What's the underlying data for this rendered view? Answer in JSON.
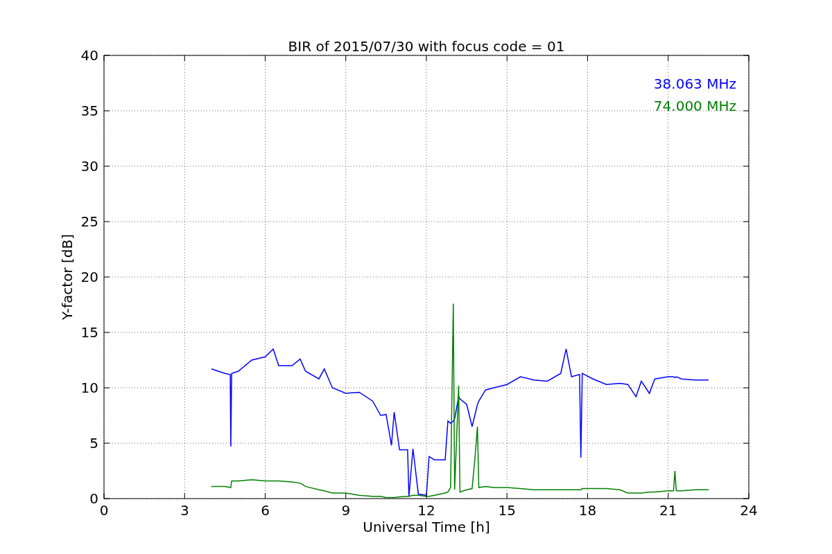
{
  "figure": {
    "chart_data": {
      "type": "line",
      "title": "BIR of 2015/07/30 with focus code = 01",
      "xlabel": "Universal Time [h]",
      "ylabel": "Y-factor [dB]",
      "grid": true,
      "xlim": [
        0,
        24
      ],
      "ylim": [
        0,
        40
      ],
      "xticks": [
        0,
        3,
        6,
        9,
        12,
        15,
        18,
        21,
        24
      ],
      "yticks": [
        0,
        5,
        10,
        15,
        20,
        25,
        30,
        35,
        40
      ],
      "x": [
        4,
        4.5,
        4.7,
        4.72,
        4.75,
        5,
        5.5,
        6,
        6.3,
        6.5,
        7,
        7.3,
        7.5,
        8,
        8.2,
        8.5,
        9,
        9.5,
        10,
        10.3,
        10.5,
        10.7,
        10.8,
        11,
        11.3,
        11.35,
        11.5,
        11.7,
        12,
        12.1,
        12.3,
        12.7,
        12.8,
        12.9,
        13,
        13.05,
        13.2,
        13.25,
        13.5,
        13.7,
        13.8,
        13.9,
        13.95,
        14.2,
        14.5,
        15,
        15.5,
        16,
        16.5,
        17,
        17.2,
        17.4,
        17.7,
        17.75,
        17.8,
        18.2,
        18.7,
        19.2,
        19.5,
        19.8,
        20,
        20.3,
        20.5,
        21,
        21.2,
        21.25,
        21.3,
        21.5,
        22,
        22.5
      ],
      "series": [
        {
          "name": "38.063 MHz",
          "color": "#0000ff",
          "values": [
            11.7,
            11.3,
            11.2,
            4.7,
            11.3,
            11.5,
            12.5,
            12.8,
            13.5,
            12,
            12,
            12.6,
            11.5,
            10.8,
            11.7,
            10,
            9.5,
            9.6,
            8.8,
            7.5,
            7.6,
            4.8,
            7.8,
            4.4,
            4.4,
            0.2,
            4.5,
            0.4,
            0.3,
            3.8,
            3.5,
            3.5,
            7,
            6.8,
            7,
            7.2,
            9.2,
            9,
            8.5,
            6.5,
            7.5,
            8.5,
            8.8,
            9.8,
            10,
            10.3,
            11,
            10.7,
            10.6,
            11.3,
            13.5,
            11,
            11.2,
            3.7,
            11.3,
            10.8,
            10.3,
            10.4,
            10.3,
            9.2,
            10.6,
            9.5,
            10.8,
            11,
            11,
            10.9,
            11,
            10.8,
            10.7,
            10.7
          ]
        },
        {
          "name": "74.000 MHz",
          "color": "#008000",
          "values": [
            1.1,
            1.1,
            1.0,
            1.0,
            1.6,
            1.6,
            1.7,
            1.6,
            1.6,
            1.6,
            1.5,
            1.4,
            1.1,
            0.8,
            0.7,
            0.5,
            0.5,
            0.3,
            0.2,
            0.2,
            0.1,
            0.1,
            0.1,
            0.15,
            0.2,
            0.2,
            0.3,
            0.3,
            0.2,
            0.2,
            0.3,
            0.5,
            0.6,
            1,
            17.6,
            0.8,
            10.2,
            0.6,
            0.8,
            0.9,
            3.5,
            6.5,
            1,
            1.1,
            1,
            1,
            0.9,
            0.8,
            0.8,
            0.8,
            0.8,
            0.8,
            0.8,
            0.8,
            0.9,
            0.9,
            0.9,
            0.8,
            0.5,
            0.5,
            0.5,
            0.6,
            0.6,
            0.7,
            0.7,
            2.5,
            0.7,
            0.7,
            0.8,
            0.8
          ]
        }
      ]
    }
  }
}
